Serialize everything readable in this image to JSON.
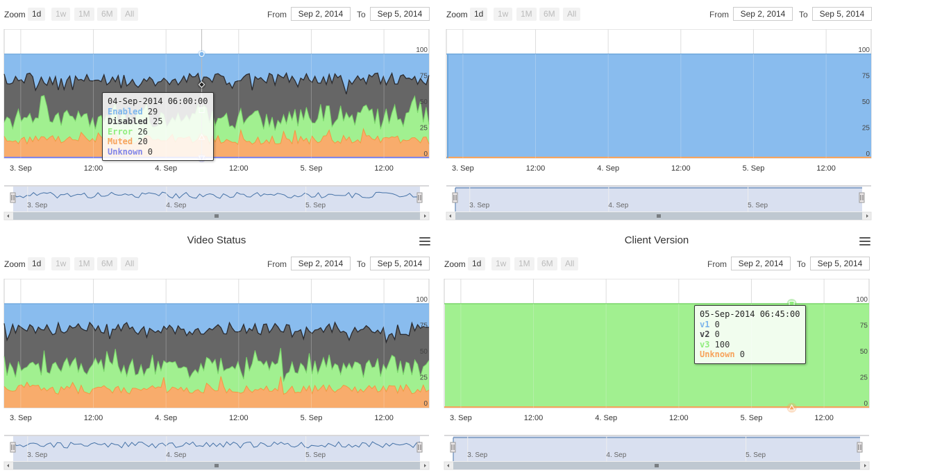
{
  "colors": {
    "blue": "#7cb5ec",
    "dark": "#434348",
    "green": "#90ed7d",
    "orange": "#f7a35c",
    "purple": "#8085e9"
  },
  "range_selector": {
    "zoom_label": "Zoom",
    "buttons": [
      "1d",
      "1w",
      "1M",
      "6M",
      "All"
    ],
    "active": "1d",
    "from_label": "From",
    "to_label": "To",
    "from_value": "Sep 2, 2014",
    "to_value": "Sep 5, 2014"
  },
  "x_ticks": [
    "3. Sep",
    "12:00",
    "4. Sep",
    "12:00",
    "5. Sep",
    "12:00"
  ],
  "navigator_ticks": [
    "3. Sep",
    "4. Sep",
    "5. Sep"
  ],
  "y_ticks": [
    0,
    25,
    50,
    75,
    100
  ],
  "charts": [
    {
      "title": "",
      "has_menu": false,
      "tooltip": {
        "time": "04-Sep-2014 06:00:00",
        "rows": [
          {
            "name": "Enabled",
            "value": "29",
            "color": "#7cb5ec"
          },
          {
            "name": "Disabled",
            "value": "25",
            "color": "#434348"
          },
          {
            "name": "Error",
            "value": "26",
            "color": "#90ed7d"
          },
          {
            "name": "Muted",
            "value": "20",
            "color": "#f7a35c"
          },
          {
            "name": "Unknown",
            "value": "0",
            "color": "#8085e9"
          }
        ]
      }
    },
    {
      "title": "",
      "has_menu": false
    },
    {
      "title": "Video Status",
      "has_menu": true
    },
    {
      "title": "Client Version",
      "has_menu": true,
      "tooltip": {
        "time": "05-Sep-2014 06:45:00",
        "rows": [
          {
            "name": "v1",
            "value": "0",
            "color": "#7cb5ec"
          },
          {
            "name": "v2",
            "value": "0",
            "color": "#434348"
          },
          {
            "name": "v3",
            "value": "100",
            "color": "#90ed7d"
          },
          {
            "name": "Unknown",
            "value": "0",
            "color": "#f7a35c"
          }
        ]
      }
    }
  ],
  "chart_data": [
    {
      "type": "area",
      "stacking": "percent",
      "x_range": [
        "2014-09-02 20:00",
        "2014-09-05 14:00"
      ],
      "ylim": [
        0,
        100
      ],
      "series": [
        {
          "name": "Enabled",
          "approx_share": [
            22,
            32
          ]
        },
        {
          "name": "Disabled",
          "approx_share": [
            20,
            35
          ]
        },
        {
          "name": "Error",
          "approx_share": [
            15,
            32
          ]
        },
        {
          "name": "Muted",
          "approx_share": [
            12,
            25
          ]
        },
        {
          "name": "Unknown",
          "approx_share": [
            0,
            0
          ]
        }
      ],
      "sample_point": {
        "x": "2014-09-04 06:00",
        "Enabled": 29,
        "Disabled": 25,
        "Error": 26,
        "Muted": 20,
        "Unknown": 0
      }
    },
    {
      "type": "area",
      "stacking": "percent",
      "x_range": [
        "2014-09-02 20:00",
        "2014-09-05 14:00"
      ],
      "ylim": [
        0,
        100
      ],
      "series": [
        {
          "name": "blue-series",
          "approx_share": [
            100,
            100
          ]
        }
      ]
    },
    {
      "type": "area",
      "stacking": "percent",
      "title": "Video Status",
      "x_range": [
        "2014-09-02 20:00",
        "2014-09-05 14:00"
      ],
      "ylim": [
        0,
        100
      ],
      "series": [
        {
          "approx_share": [
            22,
            32
          ]
        },
        {
          "approx_share": [
            20,
            35
          ]
        },
        {
          "approx_share": [
            15,
            32
          ]
        },
        {
          "approx_share": [
            12,
            25
          ]
        }
      ]
    },
    {
      "type": "area",
      "stacking": "percent",
      "title": "Client Version",
      "x_range": [
        "2014-09-02 20:00",
        "2014-09-05 14:00"
      ],
      "ylim": [
        0,
        100
      ],
      "series": [
        {
          "name": "v1",
          "approx_share": [
            0,
            0
          ]
        },
        {
          "name": "v2",
          "approx_share": [
            0,
            0
          ]
        },
        {
          "name": "v3",
          "approx_share": [
            100,
            100
          ]
        },
        {
          "name": "Unknown",
          "approx_share": [
            0,
            0
          ]
        }
      ],
      "sample_point": {
        "x": "2014-09-05 06:45",
        "v1": 0,
        "v2": 0,
        "v3": 100,
        "Unknown": 0
      }
    }
  ]
}
